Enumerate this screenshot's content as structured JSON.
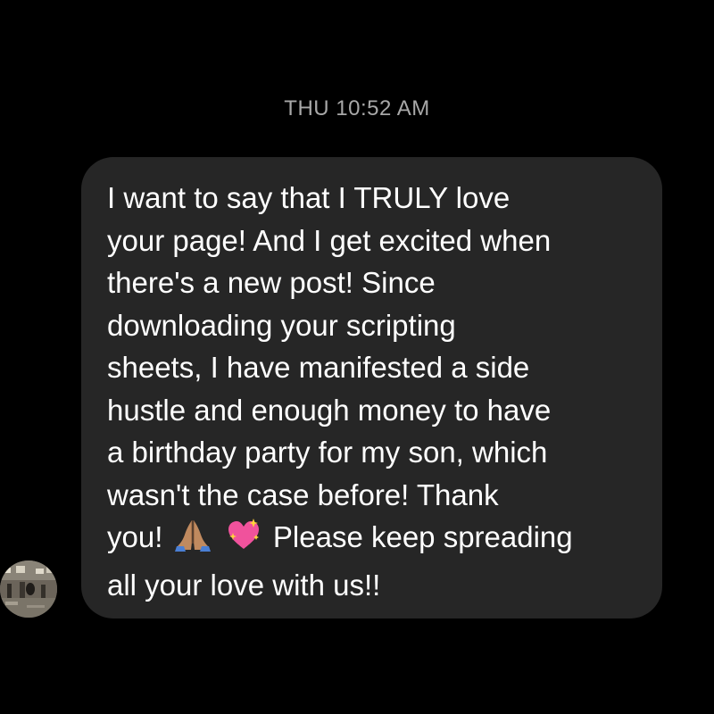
{
  "thread": {
    "timestamp": "THU 10:52 AM"
  },
  "message": {
    "lines": [
      "I want to say that I TRULY love",
      "your page! And I get excited when",
      "there's a new post! Since",
      "downloading your scripting",
      "sheets, I have manifested a side",
      "hustle and enough money to have",
      "a birthday party for my son, which",
      "wasn't the case before! Thank"
    ],
    "line9_start": "you!",
    "emojis": [
      "folded-hands-icon",
      "sparkling-heart-icon"
    ],
    "line9_end": "Please keep spreading",
    "line10": "all your love with us!!"
  },
  "colors": {
    "background": "#000000",
    "bubble": "#262626",
    "text": "#ffffff",
    "timestamp": "#a8a8a8"
  }
}
